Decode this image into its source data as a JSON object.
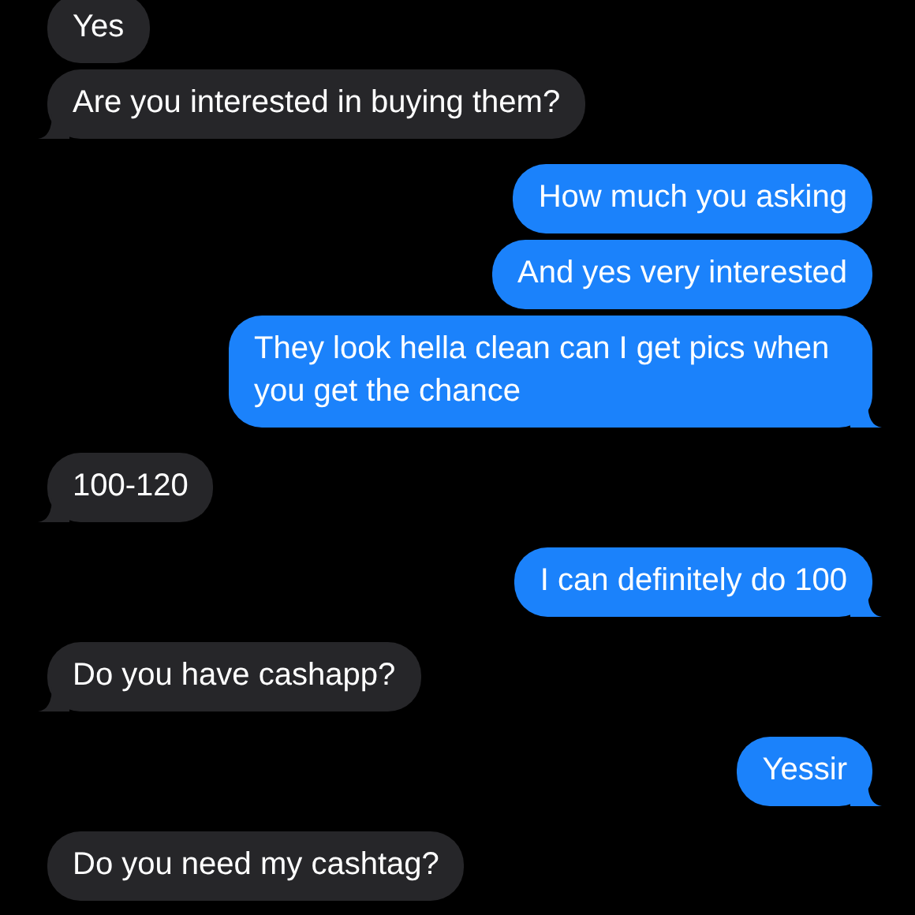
{
  "messages": [
    {
      "kind": "received",
      "text": "Yes",
      "tail": false
    },
    {
      "kind": "received",
      "text": "Are you interested in buying them?",
      "tail": true
    },
    {
      "kind": "sent",
      "text": "How much you asking",
      "tail": false
    },
    {
      "kind": "sent",
      "text": "And yes very interested",
      "tail": false
    },
    {
      "kind": "sent",
      "text": "They look hella clean can I get pics when you get the chance",
      "tail": true
    },
    {
      "kind": "received",
      "text": "100-120",
      "tail": true
    },
    {
      "kind": "sent",
      "text": "I can definitely do 100",
      "tail": true
    },
    {
      "kind": "received",
      "text": "Do you have cashapp?",
      "tail": true
    },
    {
      "kind": "sent",
      "text": "Yessir",
      "tail": true
    },
    {
      "kind": "received",
      "text": "Do you need my cashtag?",
      "tail": false
    }
  ]
}
